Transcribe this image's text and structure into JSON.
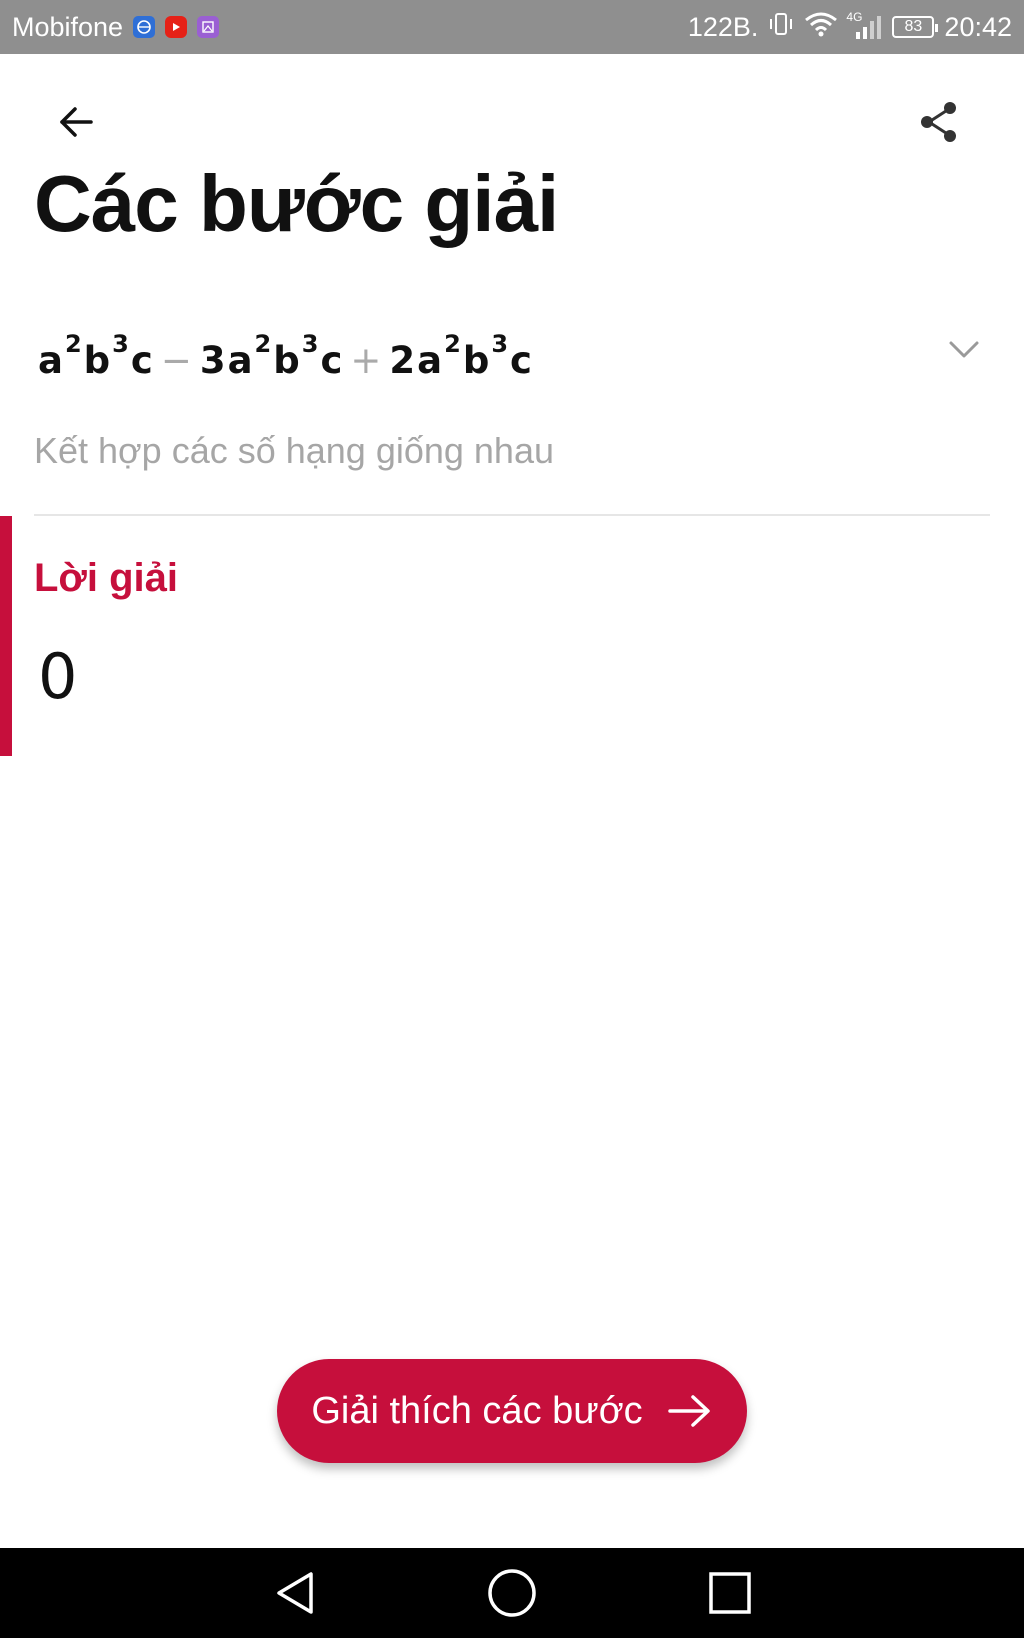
{
  "status_bar": {
    "carrier": "Mobifone",
    "speed": "122B.",
    "network": "4G",
    "battery": "83",
    "time": "20:42",
    "icons": [
      "browser-app-icon",
      "youtube-app-icon",
      "gallery-app-icon",
      "vibrate-icon",
      "wifi-icon",
      "signal-icon",
      "battery-icon"
    ]
  },
  "header": {
    "title": "Các bước giải",
    "back_icon": "arrow-left-icon",
    "share_icon": "share-icon"
  },
  "step": {
    "terms": [
      {
        "coef": "",
        "a": "a",
        "a_exp": "2",
        "b": "b",
        "b_exp": "3",
        "c": "c"
      },
      {
        "op": "−"
      },
      {
        "coef": "3",
        "a": "a",
        "a_exp": "2",
        "b": "b",
        "b_exp": "3",
        "c": "c"
      },
      {
        "op": "+"
      },
      {
        "coef": "2",
        "a": "a",
        "a_exp": "2",
        "b": "b",
        "b_exp": "3",
        "c": "c"
      }
    ],
    "description": "Kết hợp các số hạng giống nhau",
    "expand_icon": "chevron-down-icon"
  },
  "solution": {
    "label": "Lời giải",
    "value": "0"
  },
  "cta": {
    "label": "Giải thích các bước",
    "icon": "arrow-right-icon"
  },
  "colors": {
    "accent": "#c60f3c",
    "status_bar": "#8f8f8f",
    "muted_text": "#a6a6a6"
  }
}
